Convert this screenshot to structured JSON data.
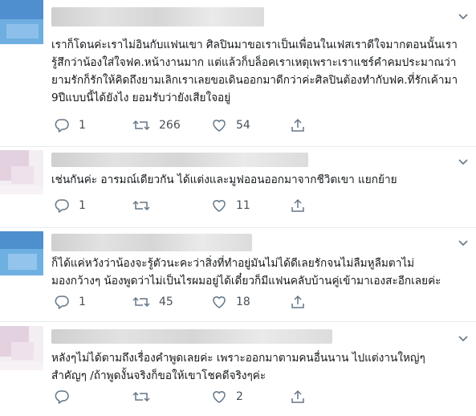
{
  "tweets": [
    {
      "lines": [
        "เราก็โดนค่ะเราไม่อินกับแฟนเขา ศิลปินมาขอเราเป็นเพื่อนในเฟสเราดีใจมากตอนนั้นเรา",
        "รู้สึกว่าน้องใส่ใจฟค.หน้างานมาก แต่แล้วก็บล็อคเราเหตุเพราะเราแชร์คำคมประมาณว่า",
        "ยามรักก็รักให้คิดถึงยามเลิกเราเลยขอเดินออกมาดีกว่าค่ะศิลปินต้องทำกับฟค.ที่รักเค้ามา",
        "9ปีแบบนี้ได้ยังไง ยอมรับว่ายังเสียใจอยู่"
      ],
      "reply_count": "1",
      "retweet_count": "266",
      "like_count": "54"
    },
    {
      "lines": [
        "เช่นกันค่ะ อารมณ์เดียวกัน ได้แต่งและมูฟออนออกมาจากชีวิตเขา แยกย้าย"
      ],
      "reply_count": "1",
      "retweet_count": "",
      "like_count": "11"
    },
    {
      "lines": [
        "ก็ได้แค่หวังว่าน้องจะรู้ตัวนะคะว่าสิ่งที่ทำอยู่มันไม่ได้ดีเลยรักจนไม่ลืมหูลืมตาไม่",
        "มองกว้างๆ น้องพูดว่าไม่เป็นไรผมอยู่ได้เดี๋ยวก็มีแฟนคลับบ้านคู่เข้ามาเองสะอีกเลยค่ะ"
      ],
      "reply_count": "1",
      "retweet_count": "45",
      "like_count": "18"
    },
    {
      "lines": [
        "หลังๆไม่ได้ตามถึงเรื่องคำพูดเลยค่ะ เพราะออกมาตามคนอื่นนาน ไปแต่งานใหญ่ๆ",
        "สำคัญๆ /ถ้าพูดงั้นจริงก็ขอให้เขาโชคดีจริงๆค่ะ"
      ],
      "reply_count": "",
      "retweet_count": "",
      "like_count": "2"
    }
  ],
  "icons": {
    "reply": "reply-icon",
    "retweet": "retweet-icon",
    "like": "heart-icon",
    "share": "share-icon",
    "menu": "chevron-down-icon"
  },
  "colors": {
    "text": "#14171a",
    "icon": "#657786",
    "divider": "#e6ecf0",
    "avatar_blue": "#5b9fd6",
    "avatar_pink": "#e8d7e4"
  }
}
